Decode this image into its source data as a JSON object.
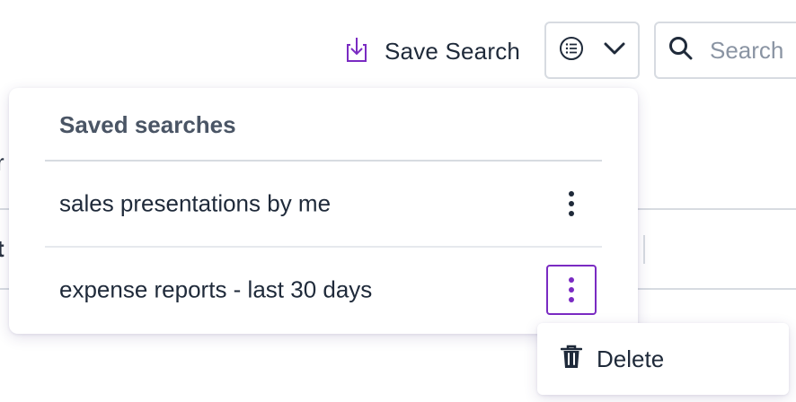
{
  "toolbar": {
    "save_search_label": "Save Search",
    "search_placeholder": "Search"
  },
  "saved_searches_menu": {
    "title": "Saved searches",
    "items": [
      {
        "label": "sales presentations by me",
        "actions_open": false
      },
      {
        "label": "expense reports - last 30 days",
        "actions_open": true
      }
    ]
  },
  "context_menu": {
    "items": [
      {
        "label": "Delete",
        "icon": "trash-icon"
      }
    ]
  },
  "background": {
    "fragment_1": "r",
    "fragment_2": "t"
  },
  "colors": {
    "accent": "#7a2bc2",
    "text": "#1f2a3a",
    "muted": "#4a5565",
    "border": "#d7dbe1"
  }
}
